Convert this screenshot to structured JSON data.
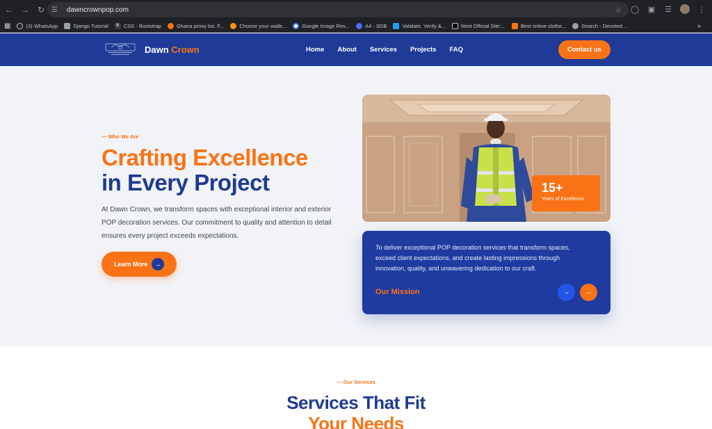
{
  "browser": {
    "url": "dawncrownpop.com",
    "bookmarks": [
      {
        "label": "(3) WhatsApp",
        "color": "#25d366"
      },
      {
        "label": "Django Tutorial",
        "color": "#9aa0a6"
      },
      {
        "label": "CSS - Bootstrap",
        "color": "#3b3b3b"
      },
      {
        "label": "Ghana proxy list. F...",
        "color": "#f97316"
      },
      {
        "label": "Choose your walle...",
        "color": "#f7931a"
      },
      {
        "label": "Google Image Res...",
        "color": "#4285f4"
      },
      {
        "label": "A4 - SDB",
        "color": "#4a6cf7"
      },
      {
        "label": "Validate, Verify &...",
        "color": "#1da1f2"
      },
      {
        "label": "Next Official Site:...",
        "color": "#000000"
      },
      {
        "label": "Best online clothe...",
        "color": "#f97316"
      },
      {
        "label": "Search - Devoted:...",
        "color": "#9aa0a6"
      }
    ],
    "more": "»"
  },
  "header": {
    "brand_first": "Dawn",
    "brand_second": "Crown",
    "nav": [
      "Home",
      "About",
      "Services",
      "Projects",
      "FAQ"
    ],
    "contact_label": "Contact us"
  },
  "hero": {
    "eyebrow": "— Who We Are",
    "headline_line1": "Crafting Excellence",
    "headline_line2": "in Every Project",
    "description": "At Dawn Crown, we transform spaces with exceptional interior and exterior POP decoration services. Our commitment to quality and attention to detail ensures every project exceeds expectations.",
    "cta_label": "Learn More",
    "stat_number": "15+",
    "stat_label": "Years of Excellence"
  },
  "mission": {
    "text": "To deliver exceptional POP decoration services that transform spaces, exceed client expectations, and create lasting impressions through innovation, quality, and unwavering dedication to our craft.",
    "title": "Our Mission"
  },
  "services": {
    "eyebrow": "— Our Services",
    "title_line1": "Services That Fit",
    "title_line2": "Your Needs"
  },
  "colors": {
    "brand_blue": "#1f3b97",
    "accent_orange": "#f97316"
  }
}
